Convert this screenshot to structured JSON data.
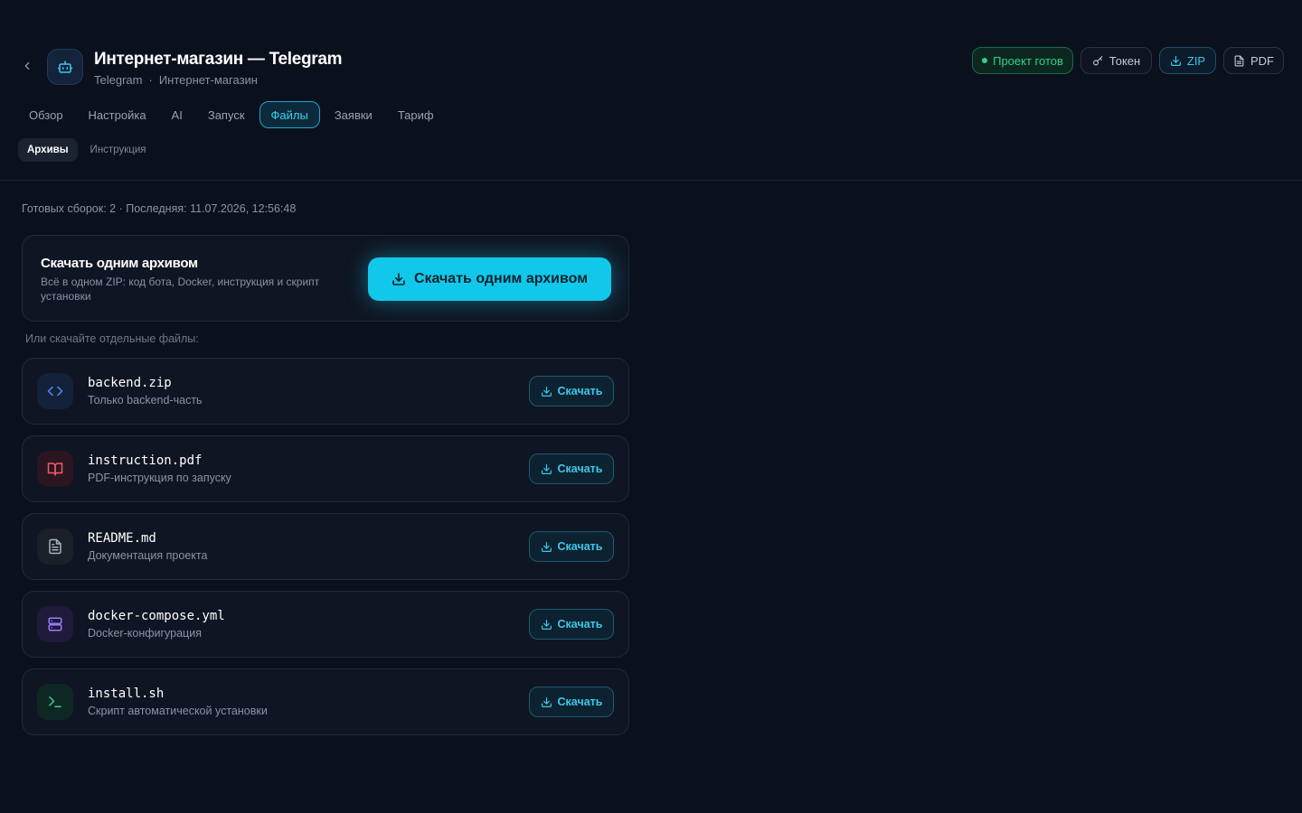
{
  "header": {
    "title": "Интернет-магазин — Telegram",
    "breadcrumb": [
      "Telegram",
      "·",
      "Интернет-магазин"
    ],
    "status_label": "Проект готов",
    "token_label": "Токен",
    "zip_label": "ZIP",
    "pdf_label": "PDF",
    "status_color": "#2fd38a",
    "accent_color": "#12c8ea"
  },
  "tabs": [
    {
      "label": "Обзор",
      "active": false
    },
    {
      "label": "Настройка",
      "active": false
    },
    {
      "label": "AI",
      "active": false
    },
    {
      "label": "Запуск",
      "active": false
    },
    {
      "label": "Файлы",
      "active": true
    },
    {
      "label": "Заявки",
      "active": false
    },
    {
      "label": "Тариф",
      "active": false
    }
  ],
  "subtabs": [
    {
      "label": "Архивы",
      "active": true
    },
    {
      "label": "Инструкция",
      "active": false
    }
  ],
  "meta": "Готовых сборок: 2 · Последняя: 11.07.2026, 12:56:48",
  "archive": {
    "title": "Скачать одним архивом",
    "description": "Всё в одном ZIP: код бота, Docker, инструкция и скрипт установки",
    "button_label": "Скачать одним архивом"
  },
  "separate_label": "Или скачайте отдельные файлы:",
  "files": [
    {
      "name": "backend.zip",
      "description": "Только backend-часть",
      "icon": "code-icon",
      "button_label": "Скачать"
    },
    {
      "name": "instruction.pdf",
      "description": "PDF-инструкция по запуску",
      "icon": "book-open-icon",
      "button_label": "Скачать"
    },
    {
      "name": "README.md",
      "description": "Документация проекта",
      "icon": "file-text-icon",
      "button_label": "Скачать"
    },
    {
      "name": "docker-compose.yml",
      "description": "Docker-конфигурация",
      "icon": "server-icon",
      "button_label": "Скачать"
    },
    {
      "name": "install.sh",
      "description": "Скрипт автоматической установки",
      "icon": "terminal-icon",
      "button_label": "Скачать"
    }
  ]
}
